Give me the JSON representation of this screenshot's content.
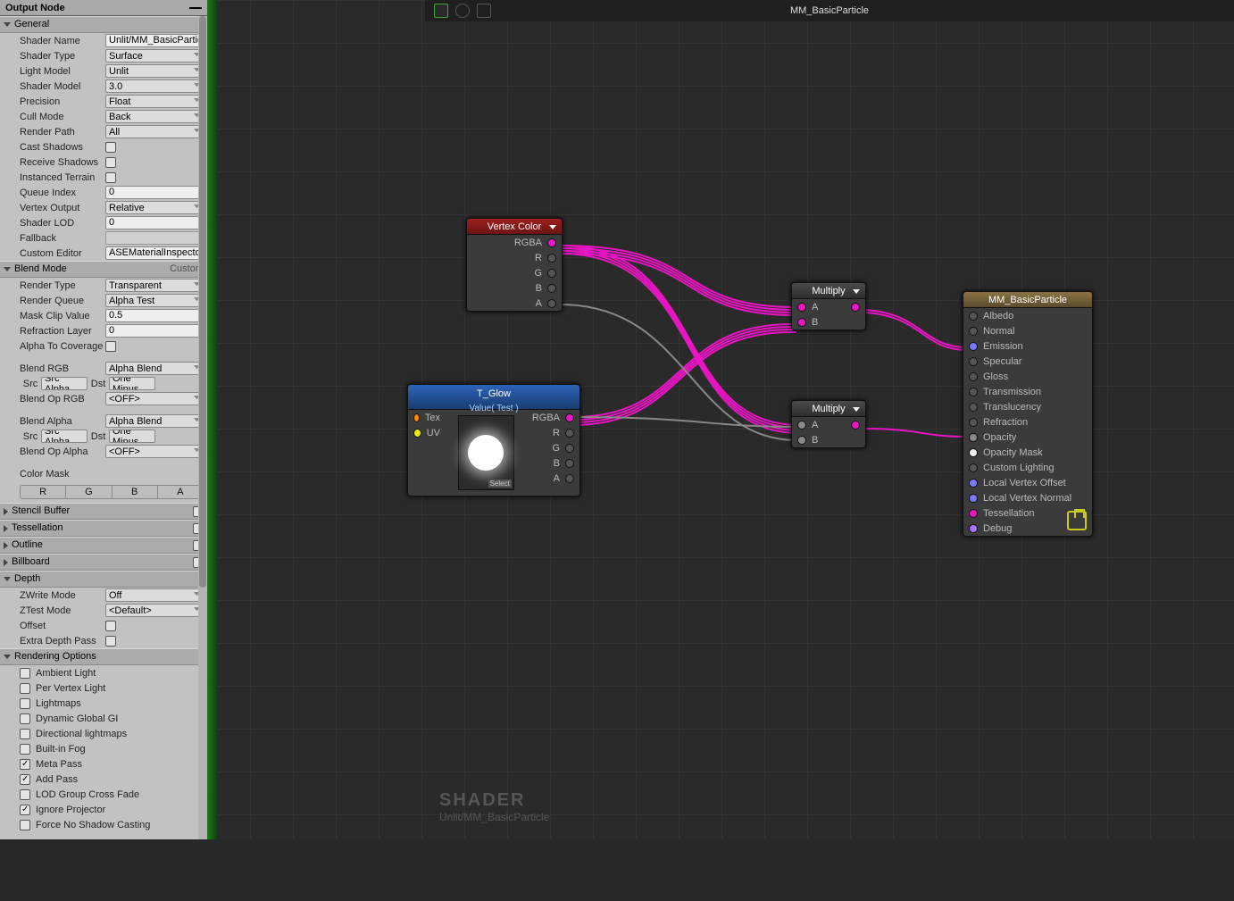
{
  "inspector": {
    "title": "Output Node",
    "sections": {
      "general": {
        "label": "General",
        "shader_name_label": "Shader Name",
        "shader_name": "Unlit/MM_BasicParticle",
        "shader_type_label": "Shader Type",
        "shader_type": "Surface",
        "light_model_label": "Light Model",
        "light_model": "Unlit",
        "shader_model_label": "Shader Model",
        "shader_model": "3.0",
        "precision_label": "Precision",
        "precision": "Float",
        "cull_mode_label": "Cull Mode",
        "cull_mode": "Back",
        "render_path_label": "Render Path",
        "render_path": "All",
        "cast_shadows_label": "Cast Shadows",
        "cast_shadows": false,
        "receive_shadows_label": "Receive Shadows",
        "receive_shadows": false,
        "instanced_terrain_label": "Instanced Terrain",
        "instanced_terrain": false,
        "queue_index_label": "Queue Index",
        "queue_index": "0",
        "vertex_output_label": "Vertex Output",
        "vertex_output": "Relative",
        "shader_lod_label": "Shader LOD",
        "shader_lod": "0",
        "fallback_label": "Fallback",
        "fallback": "",
        "custom_editor_label": "Custom Editor",
        "custom_editor": "ASEMaterialInspector"
      },
      "blend": {
        "label": "Blend Mode",
        "aux": "Custom",
        "render_type_label": "Render Type",
        "render_type": "Transparent",
        "render_queue_label": "Render Queue",
        "render_queue": "Alpha Test",
        "mask_clip_label": "Mask Clip Value",
        "mask_clip": "0.5",
        "refraction_layer_label": "Refraction Layer",
        "refraction_layer": "0",
        "alpha_cov_label": "Alpha To Coverage",
        "alpha_cov": false,
        "blend_rgb_label": "Blend RGB",
        "blend_rgb": "Alpha Blend",
        "src_label": "Src",
        "dst_label": "Dst",
        "src_rgb": "Src Alpha",
        "dst_rgb": "One Minus",
        "blend_op_rgb_label": "Blend Op RGB",
        "blend_op_rgb": "<OFF>",
        "blend_alpha_label": "Blend Alpha",
        "blend_alpha": "Alpha Blend",
        "src_alpha": "Src Alpha",
        "dst_alpha": "One Minus",
        "blend_op_alpha_label": "Blend Op Alpha",
        "blend_op_alpha": "<OFF>",
        "color_mask_label": "Color Mask",
        "color_mask": [
          "R",
          "G",
          "B",
          "A"
        ]
      },
      "stencil": {
        "label": "Stencil Buffer"
      },
      "tess": {
        "label": "Tessellation"
      },
      "outline": {
        "label": "Outline"
      },
      "billboard": {
        "label": "Billboard"
      },
      "depth": {
        "label": "Depth",
        "zwrite_label": "ZWrite Mode",
        "zwrite": "Off",
        "ztest_label": "ZTest Mode",
        "ztest": "<Default>",
        "offset_label": "Offset",
        "offset": false,
        "extra_label": "Extra Depth Pass",
        "extra": false
      },
      "render": {
        "label": "Rendering Options",
        "opts": [
          {
            "label": "Ambient Light",
            "on": false
          },
          {
            "label": "Per Vertex Light",
            "on": false
          },
          {
            "label": "Lightmaps",
            "on": false
          },
          {
            "label": "Dynamic Global GI",
            "on": false
          },
          {
            "label": "Directional lightmaps",
            "on": false
          },
          {
            "label": "Built-in Fog",
            "on": false
          },
          {
            "label": "Meta Pass",
            "on": true
          },
          {
            "label": "Add Pass",
            "on": true
          },
          {
            "label": "LOD Group Cross Fade",
            "on": false
          },
          {
            "label": "Ignore Projector",
            "on": true
          },
          {
            "label": "Force No Shadow Casting",
            "on": false
          }
        ]
      }
    }
  },
  "canvas": {
    "title": "MM_BasicParticle",
    "watermark_big": "SHADER",
    "watermark_sub": "Unlit/MM_BasicParticle",
    "nodes": {
      "vertex_color": {
        "title": "Vertex Color",
        "ports": [
          "RGBA",
          "R",
          "G",
          "B",
          "A"
        ]
      },
      "multiply1": {
        "title": "Multiply",
        "in": [
          "A",
          "B"
        ]
      },
      "multiply2": {
        "title": "Multiply",
        "in": [
          "A",
          "B"
        ]
      },
      "tglow": {
        "title": "T_Glow",
        "sub": "Value( Test )",
        "in": [
          "Tex",
          "UV"
        ],
        "out": [
          "RGBA",
          "R",
          "G",
          "B",
          "A"
        ],
        "select": "Select"
      },
      "output": {
        "title": "MM_BasicParticle",
        "ports": [
          {
            "label": "Albedo",
            "col": "empty"
          },
          {
            "label": "Normal",
            "col": "empty"
          },
          {
            "label": "Emission",
            "col": "blue"
          },
          {
            "label": "Specular",
            "col": "empty"
          },
          {
            "label": "Gloss",
            "col": "empty"
          },
          {
            "label": "Transmission",
            "col": "empty"
          },
          {
            "label": "Translucency",
            "col": "empty"
          },
          {
            "label": "Refraction",
            "col": "empty"
          },
          {
            "label": "Opacity",
            "col": "gray"
          },
          {
            "label": "Opacity Mask",
            "col": "white"
          },
          {
            "label": "Custom Lighting",
            "col": "empty"
          },
          {
            "label": "Local Vertex Offset",
            "col": "blue"
          },
          {
            "label": "Local Vertex Normal",
            "col": "blue"
          },
          {
            "label": "Tessellation",
            "col": "filled"
          },
          {
            "label": "Debug",
            "col": "purple"
          }
        ]
      }
    }
  }
}
